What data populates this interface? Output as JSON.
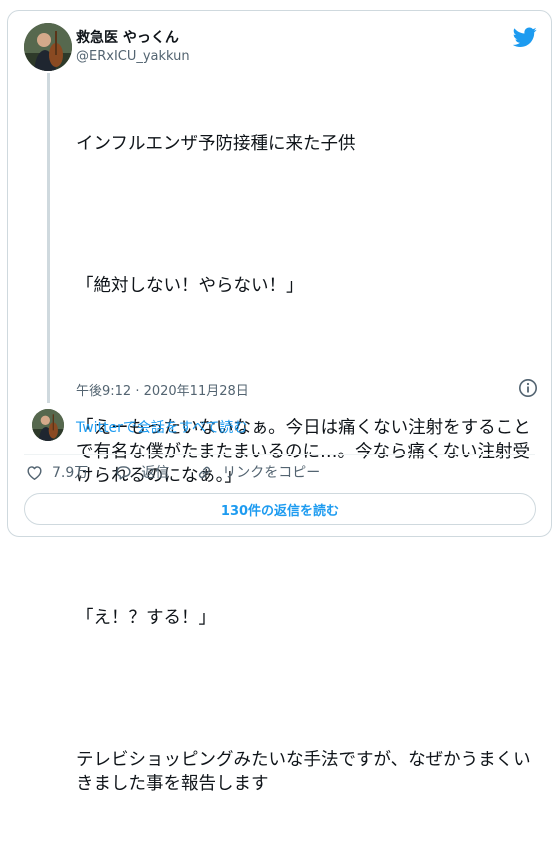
{
  "user": {
    "name": "救急医 やっくん",
    "handle": "@ERxICU_yakkun"
  },
  "tweet": {
    "lines": [
      "インフルエンザ予防接種に来た子供",
      "「絶対しない！やらない！」",
      "「えーもったいないなぁ。今日は痛くない注射をすることで有名な僕がたまたまいるのに…。今なら痛くない注射受けられるのになぁ。」",
      "「え！？する！」",
      "テレビショッピングみたいな手法ですが、なぜかうまくいきました事を報告します"
    ],
    "timestamp": "午後9:12 · 2020年11月28日"
  },
  "conversation_link": "Twitterで会話をすべて読む",
  "actions": {
    "likes": "7.9万",
    "reply": "返信",
    "copy_link": "リンクをコピー"
  },
  "replies_button": "130件の返信を読む",
  "colors": {
    "accent": "#1d9bf0",
    "secondary_text": "#536471",
    "border": "#cfd9de",
    "text": "#0f1419"
  },
  "icons": [
    "twitter-bird-icon",
    "info-icon",
    "heart-icon",
    "reply-icon",
    "link-icon"
  ]
}
